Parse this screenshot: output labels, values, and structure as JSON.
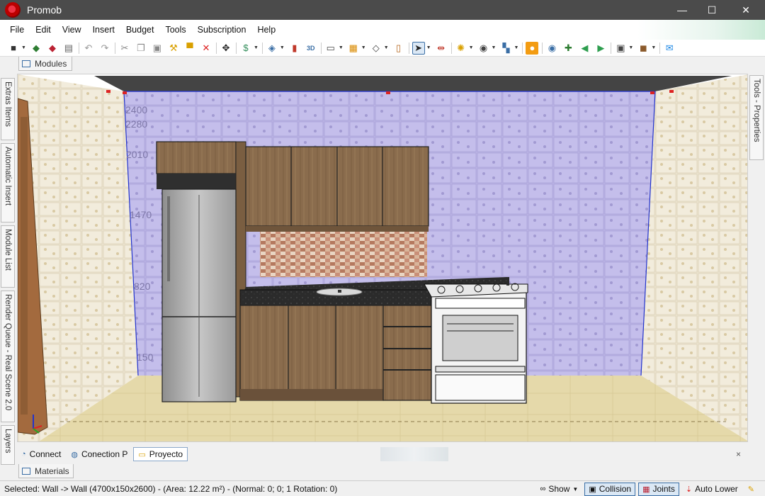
{
  "window": {
    "title": "Promob",
    "minimize": "—",
    "maximize": "☐",
    "close": "✕"
  },
  "menu": [
    "File",
    "Edit",
    "View",
    "Insert",
    "Budget",
    "Tools",
    "Subscription",
    "Help"
  ],
  "modules_tab": "Modules",
  "left_tabs": [
    "Extras Items",
    "Automatic Insert",
    "Module List",
    "Render Queue - Real Scene 2.0",
    "Layers"
  ],
  "right_tab": "Tools - Properties",
  "scene": {
    "height_marks": [
      "2400",
      "2280",
      "2010",
      "1470",
      "820",
      "150"
    ],
    "colors": {
      "back_wall": "#b9b2e3",
      "side_wall": "#ebe3cf",
      "floor": "#e5d9aa",
      "ceiling": "#444444",
      "wood": "#8a6c4d",
      "counter": "#2b2b2b",
      "steel": "#a9a9a9",
      "stove": "#f4f4f4"
    }
  },
  "bottom_tabs": [
    {
      "label": "Connect",
      "icon": "wifi-icon"
    },
    {
      "label": "Conection P",
      "icon": "globe-icon"
    },
    {
      "label": "Proyecto",
      "icon": "folder-icon",
      "active": true
    }
  ],
  "bottom_close": "×",
  "materials_tab": "Materials",
  "status": {
    "text": "Selected: Wall -> Wall (4700x150x2600) - (Area: 12.22 m²) - (Normal: 0; 0; 1 Rotation: 0)",
    "show": "Show",
    "collision": "Collision",
    "joints": "Joints",
    "auto_lower": "Auto Lower"
  }
}
